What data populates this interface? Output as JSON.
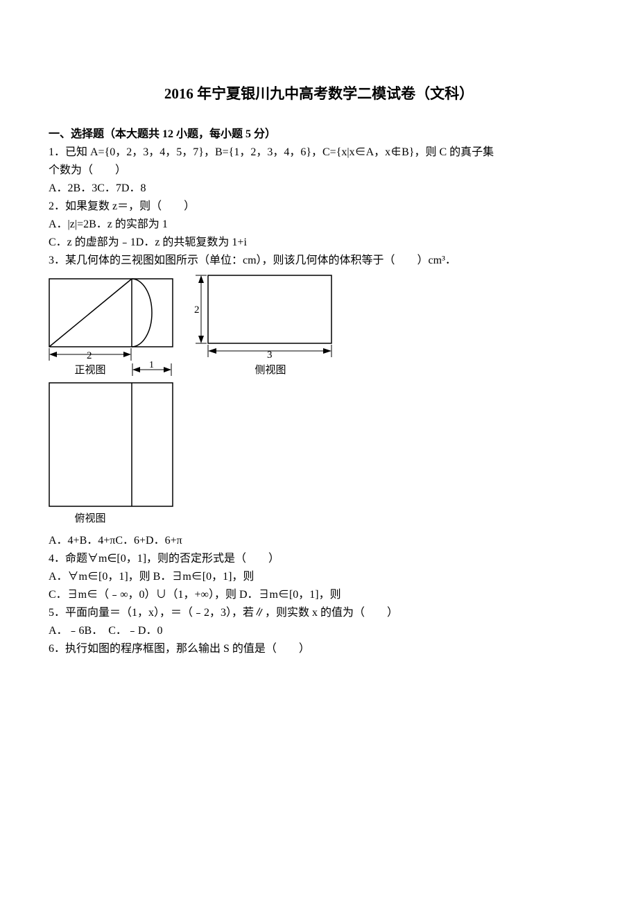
{
  "title": "2016 年宁夏银川九中高考数学二模试卷（文科）",
  "section1": {
    "header": "一、选择题（本大题共 12 小题，每小题 5 分）",
    "q1": {
      "line1": "1．已知 A={0，2，3，4，5，7}，B={1，2，3，4，6}，C={x|x∈A，x∉B}，则 C 的真子集",
      "line2": "个数为（　　）",
      "options": "A．2B．3C．7D．8"
    },
    "q2": {
      "line1": "2．如果复数 z＝，则（　　）",
      "opt1": "A．|z|=2B．z 的实部为 1",
      "opt2": "C．z 的虚部为﹣1D．z 的共轭复数为 1+i"
    },
    "q3": {
      "line1": "3．某几何体的三视图如图所示（单位：cm），则该几何体的体积等于（　　）cm³．",
      "front_label": "正视图",
      "side_label": "侧视图",
      "top_label": "俯视图",
      "dim_2a": "2",
      "dim_2b": "2",
      "dim_1": "1",
      "dim_3": "3",
      "options": "A．4+B．4+πC．6+D．6+π"
    },
    "q4": {
      "line1": "4．命题∀m∈[0，1]，则的否定形式是（　　）",
      "opt1": "A．∀m∈[0，1]，则 B．∃m∈[0，1]，则",
      "opt2": "C．∃m∈（﹣∞，0）∪（1，+∞），则 D．∃m∈[0，1]，则"
    },
    "q5": {
      "line1": "5．平面向量＝（1，x），＝（﹣2，3），若∥，则实数 x 的值为（　　）",
      "options": "A．﹣6B．　C．﹣D．0"
    },
    "q6": {
      "line1": "6．执行如图的程序框图，那么输出 S 的值是（　　）"
    }
  }
}
